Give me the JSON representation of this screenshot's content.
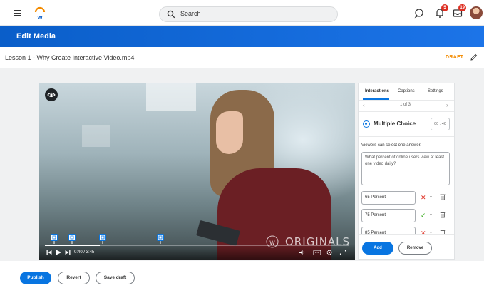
{
  "topbar": {
    "search_placeholder": "Search",
    "notifications_count": "5",
    "inbox_count": "19",
    "icons": [
      "menu-icon",
      "workday-logo",
      "search-icon",
      "chat-icon",
      "bell-icon",
      "inbox-icon",
      "avatar"
    ]
  },
  "header": {
    "title": "Edit Media"
  },
  "media": {
    "file_title": "Lesson 1 - Why Create Interactive Video.mp4",
    "status": "DRAFT"
  },
  "player": {
    "current_time": "0:40",
    "duration": "3:45",
    "time_display": "0:40 / 3:45",
    "progress": 0.18,
    "watermark": "ORIGINALS",
    "marker_positions": [
      0.03,
      0.09,
      0.19,
      0.38
    ]
  },
  "panel": {
    "tabs": [
      {
        "label": "Interactions",
        "active": true
      },
      {
        "label": "Captions",
        "active": false
      },
      {
        "label": "Settings",
        "active": false
      }
    ],
    "pager": "1 of 3",
    "interaction_type": "Multiple Choice",
    "timestamp": "00 : 40",
    "instructions": "Viewers can select one answer.",
    "question": "What percent of online users view at least one video daily?",
    "answers": [
      {
        "text": "65 Percent",
        "correct": false
      },
      {
        "text": "75 Percent",
        "correct": true
      },
      {
        "text": "85 Percent",
        "correct": false
      }
    ],
    "add_label": "Add",
    "remove_label": "Remove"
  },
  "footer": {
    "publish_label": "Publish",
    "revert_label": "Revert",
    "save_draft_label": "Save draft"
  },
  "colors": {
    "brand_blue": "#0875e1",
    "header_blue": "#0a5ec9",
    "draft_orange": "#f38b00",
    "badge_red": "#de2e21",
    "correct_green": "#43b02a",
    "incorrect_red": "#de2e21"
  }
}
